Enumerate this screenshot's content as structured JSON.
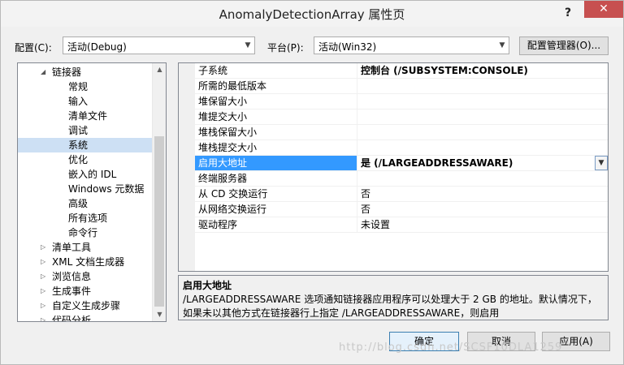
{
  "window": {
    "title": "AnomalyDetectionArray 属性页",
    "help_glyph": "?",
    "close_glyph": "✕"
  },
  "toolbar": {
    "config_label": "配置(C):",
    "config_value": "活动(Debug)",
    "platform_label": "平台(P):",
    "platform_value": "活动(Win32)",
    "config_manager_label": "配置管理器(O)..."
  },
  "tree": {
    "items": [
      {
        "label": "链接器",
        "expander": "◢",
        "level": 1,
        "selected": false
      },
      {
        "label": "常规",
        "expander": "",
        "level": 2,
        "selected": false
      },
      {
        "label": "输入",
        "expander": "",
        "level": 2,
        "selected": false
      },
      {
        "label": "清单文件",
        "expander": "",
        "level": 2,
        "selected": false
      },
      {
        "label": "调试",
        "expander": "",
        "level": 2,
        "selected": false
      },
      {
        "label": "系统",
        "expander": "",
        "level": 2,
        "selected": true
      },
      {
        "label": "优化",
        "expander": "",
        "level": 2,
        "selected": false
      },
      {
        "label": "嵌入的 IDL",
        "expander": "",
        "level": 2,
        "selected": false
      },
      {
        "label": "Windows 元数据",
        "expander": "",
        "level": 2,
        "selected": false
      },
      {
        "label": "高级",
        "expander": "",
        "level": 2,
        "selected": false
      },
      {
        "label": "所有选项",
        "expander": "",
        "level": 2,
        "selected": false
      },
      {
        "label": "命令行",
        "expander": "",
        "level": 2,
        "selected": false
      },
      {
        "label": "清单工具",
        "expander": "▷",
        "level": 1,
        "selected": false
      },
      {
        "label": "XML 文档生成器",
        "expander": "▷",
        "level": 1,
        "selected": false
      },
      {
        "label": "浏览信息",
        "expander": "▷",
        "level": 1,
        "selected": false
      },
      {
        "label": "生成事件",
        "expander": "▷",
        "level": 1,
        "selected": false
      },
      {
        "label": "自定义生成步骤",
        "expander": "▷",
        "level": 1,
        "selected": false
      },
      {
        "label": "代码分析",
        "expander": "▷",
        "level": 1,
        "selected": false
      }
    ]
  },
  "grid": {
    "rows": [
      {
        "key": "子系统",
        "value": "控制台 (/SUBSYSTEM:CONSOLE)",
        "bold": true,
        "selected": false
      },
      {
        "key": "所需的最低版本",
        "value": "",
        "bold": false,
        "selected": false
      },
      {
        "key": "堆保留大小",
        "value": "",
        "bold": false,
        "selected": false
      },
      {
        "key": "堆提交大小",
        "value": "",
        "bold": false,
        "selected": false
      },
      {
        "key": "堆栈保留大小",
        "value": "",
        "bold": false,
        "selected": false
      },
      {
        "key": "堆栈提交大小",
        "value": "",
        "bold": false,
        "selected": false
      },
      {
        "key": "启用大地址",
        "value": "是 (/LARGEADDRESSAWARE)",
        "bold": true,
        "selected": true
      },
      {
        "key": "终端服务器",
        "value": "",
        "bold": false,
        "selected": false
      },
      {
        "key": "从 CD 交换运行",
        "value": "否",
        "bold": false,
        "selected": false
      },
      {
        "key": "从网络交换运行",
        "value": "否",
        "bold": false,
        "selected": false
      },
      {
        "key": "驱动程序",
        "value": "未设置",
        "bold": false,
        "selected": false
      }
    ]
  },
  "description": {
    "title": "启用大地址",
    "text": "/LARGEADDRESSAWARE 选项通知链接器应用程序可以处理大于 2 GB 的地址。默认情况下，如果未以其他方式在链接器行上指定 /LARGEADDRESSAWARE，则启用 /LARGEADDRESSAWA..."
  },
  "buttons": {
    "ok": "确定",
    "cancel": "取消",
    "apply": "应用(A)"
  },
  "watermark": "http://blog.csdn.net/SCSF10DLA1259"
}
